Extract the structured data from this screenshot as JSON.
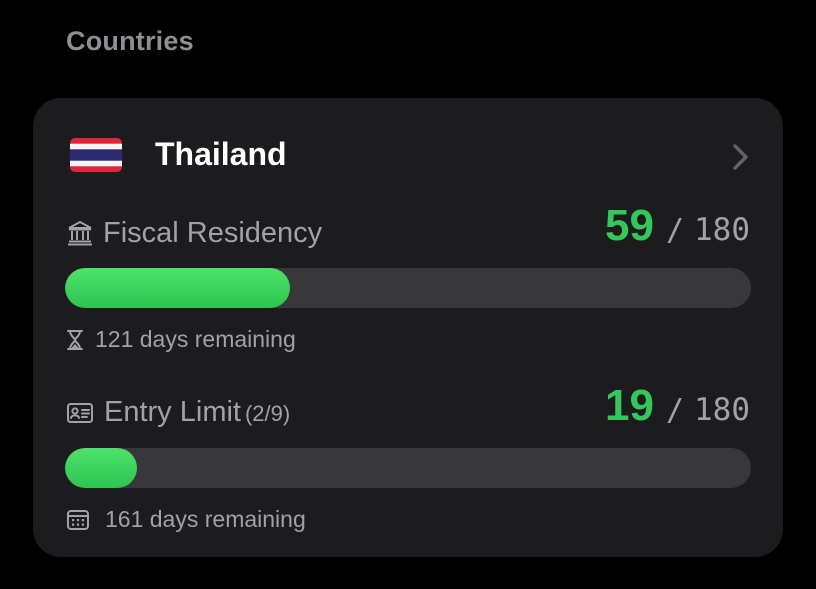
{
  "section": {
    "title": "Countries"
  },
  "country": {
    "name": "Thailand",
    "flag_icon": "thailand-flag-icon",
    "chevron_icon": "chevron-right-icon"
  },
  "metrics": [
    {
      "label": "Fiscal Residency",
      "sublabel": "",
      "icon": "bank-icon",
      "count": "59",
      "separator": "/",
      "total": "180",
      "progress_fraction": 0.3278,
      "remaining_icon": "hourglass-icon",
      "remaining_text": "121 days remaining"
    },
    {
      "label": "Entry Limit",
      "sublabel": "(2/9)",
      "icon": "id-card-icon",
      "count": "19",
      "separator": "/",
      "total": "180",
      "progress_fraction": 0.1056,
      "remaining_icon": "calendar-icon",
      "remaining_text": "161 days remaining"
    }
  ],
  "colors": {
    "accent_green": "#34c759",
    "card_background": "#1c1c1e",
    "track": "#38383a",
    "secondary_text": "#a1a1a6"
  }
}
